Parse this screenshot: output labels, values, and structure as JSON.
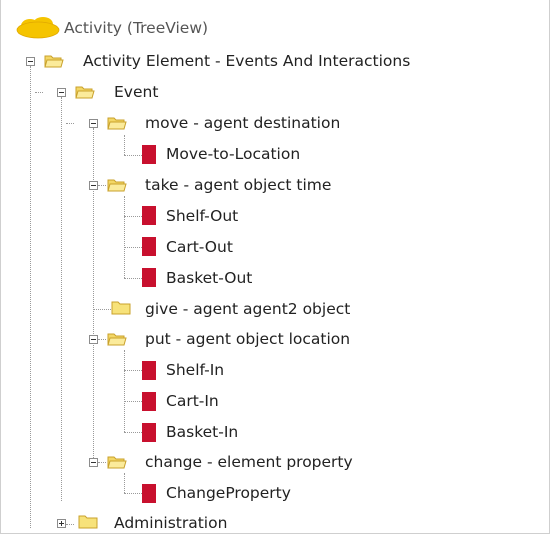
{
  "tree": {
    "root_label": "Activity (TreeView)",
    "colors": {
      "folder_fill": "#f7e27a",
      "folder_stroke": "#c9a12b",
      "leaf": "#c8102e",
      "cloud": "#f5c400"
    },
    "nodes": {
      "activity_element": "Activity Element - Events And Interactions",
      "event": "Event",
      "move": "move - agent destination",
      "move_to_location": "Move-to-Location",
      "take": "take - agent object time",
      "shelf_out": "Shelf-Out",
      "cart_out": "Cart-Out",
      "basket_out": "Basket-Out",
      "give": "give - agent agent2 object",
      "put": "put - agent object location",
      "shelf_in": "Shelf-In",
      "cart_in": "Cart-In",
      "basket_in": "Basket-In",
      "change": "change - element property",
      "change_property": "ChangeProperty",
      "administration": "Administration"
    }
  }
}
